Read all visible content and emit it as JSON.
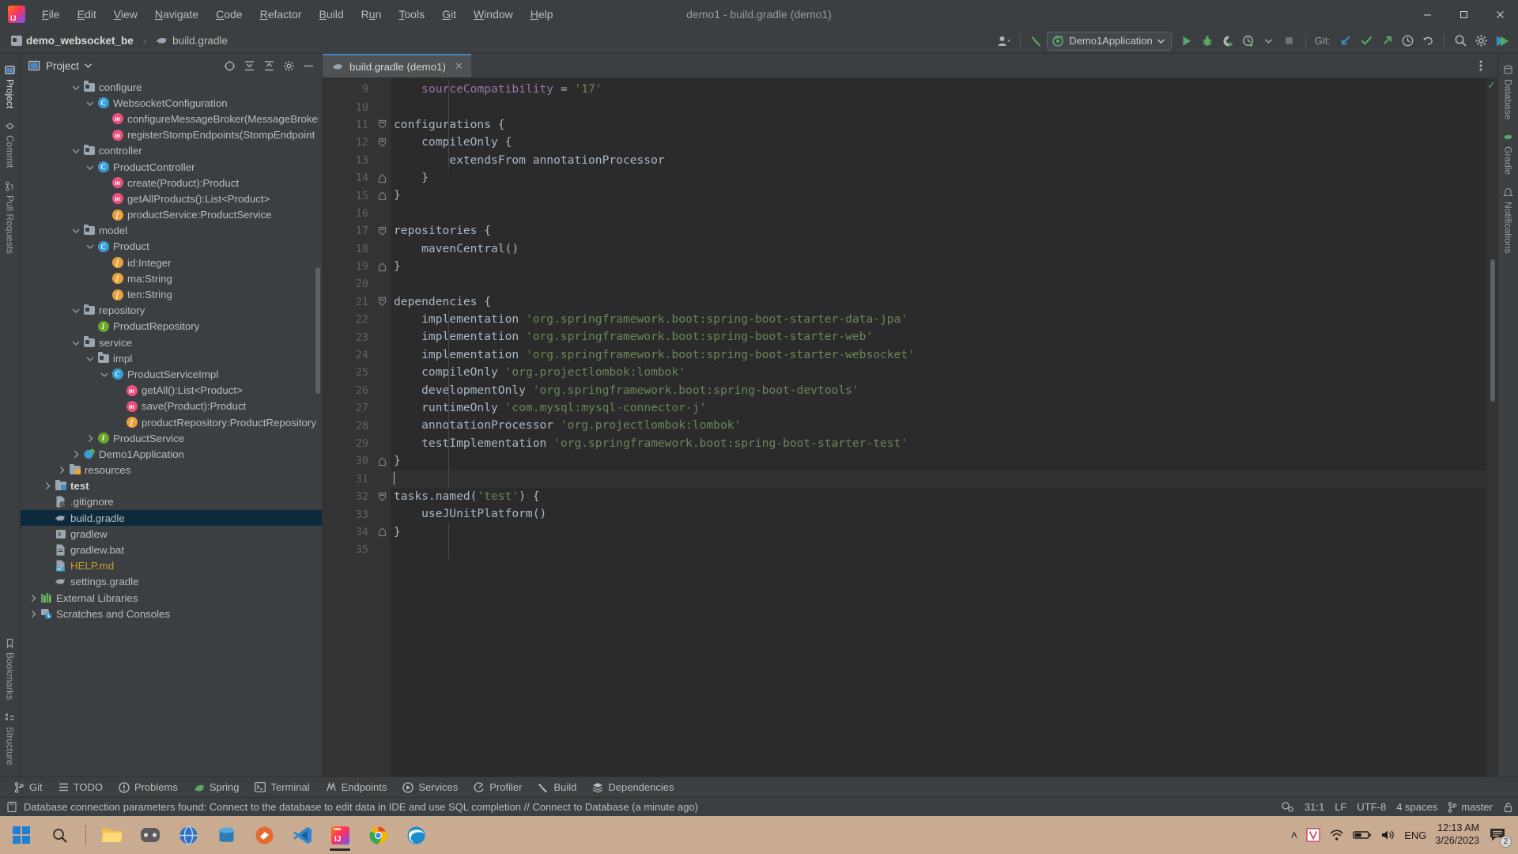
{
  "window": {
    "title": "demo1 - build.gradle (demo1)",
    "minimize_label": "─",
    "maximize_label": "❐",
    "close_label": "✕"
  },
  "menu": {
    "items": [
      {
        "label": "File",
        "mnemonic": "F"
      },
      {
        "label": "Edit",
        "mnemonic": "E"
      },
      {
        "label": "View",
        "mnemonic": "V"
      },
      {
        "label": "Navigate",
        "mnemonic": "N"
      },
      {
        "label": "Code",
        "mnemonic": "C"
      },
      {
        "label": "Refactor",
        "mnemonic": "R"
      },
      {
        "label": "Build",
        "mnemonic": "B"
      },
      {
        "label": "Run",
        "mnemonic": "u"
      },
      {
        "label": "Tools",
        "mnemonic": "T"
      },
      {
        "label": "Git",
        "mnemonic": "G"
      },
      {
        "label": "Window",
        "mnemonic": "W"
      },
      {
        "label": "Help",
        "mnemonic": "H"
      }
    ]
  },
  "navbar": {
    "breadcrumb": [
      "demo_websocket_be",
      "build.gradle"
    ],
    "separator": "›",
    "run_config": "Demo1Application",
    "git_label": "Git:",
    "buttons": [
      {
        "name": "account-icon",
        "title": "Account"
      },
      {
        "name": "build-hammer-icon",
        "title": "Build"
      },
      {
        "name": "run-icon",
        "title": "Run"
      },
      {
        "name": "debug-icon",
        "title": "Debug"
      },
      {
        "name": "run-with-coverage-icon",
        "title": "Run with Coverage"
      },
      {
        "name": "profiler-icon",
        "title": "Profiler"
      },
      {
        "name": "stop-icon",
        "title": "Stop"
      },
      {
        "name": "git-update-icon",
        "title": "Update Project"
      },
      {
        "name": "git-commit-icon",
        "title": "Commit"
      },
      {
        "name": "git-push-icon",
        "title": "Push"
      },
      {
        "name": "git-history-icon",
        "title": "History"
      },
      {
        "name": "git-rollback-icon",
        "title": "Rollback"
      },
      {
        "name": "search-everywhere-icon",
        "title": "Search Everywhere"
      },
      {
        "name": "settings-gear-icon",
        "title": "Settings"
      },
      {
        "name": "updates-icon",
        "title": "IDE and Plugin Updates"
      }
    ]
  },
  "left_strip": {
    "tabs": [
      {
        "label": "Project",
        "icon": "project-icon",
        "selected": true
      },
      {
        "label": "Commit",
        "icon": "commit-icon",
        "selected": false
      },
      {
        "label": "Pull Requests",
        "icon": "pull-request-icon",
        "selected": false
      }
    ],
    "bottom_tabs": [
      {
        "label": "Bookmarks",
        "icon": "bookmark-icon"
      },
      {
        "label": "Structure",
        "icon": "structure-icon"
      }
    ]
  },
  "right_strip": {
    "tabs": [
      {
        "label": "Database",
        "icon": "database-icon"
      },
      {
        "label": "Gradle",
        "icon": "gradle-icon"
      },
      {
        "label": "Notifications",
        "icon": "notifications-icon"
      }
    ]
  },
  "project_panel": {
    "title": "Project",
    "header_icons": [
      {
        "name": "scroll-from-source-icon"
      },
      {
        "name": "expand-all-icon"
      },
      {
        "name": "collapse-all-icon"
      },
      {
        "name": "panel-settings-gear-icon"
      },
      {
        "name": "hide-panel-icon"
      }
    ],
    "tree": [
      {
        "label": "configure",
        "indent": 4,
        "chev": "down",
        "icon": "folder-src",
        "kind": "folder"
      },
      {
        "label": "WebsocketConfiguration",
        "indent": 5,
        "chev": "down",
        "icon": "badge-c",
        "kind": "class"
      },
      {
        "label": "configureMessageBroker(MessageBroker",
        "indent": 6,
        "chev": "none",
        "icon": "badge-m",
        "kind": "method"
      },
      {
        "label": "registerStompEndpoints(StompEndpoint",
        "indent": 6,
        "chev": "none",
        "icon": "badge-m",
        "kind": "method"
      },
      {
        "label": "controller",
        "indent": 4,
        "chev": "down",
        "icon": "folder-src",
        "kind": "folder"
      },
      {
        "label": "ProductController",
        "indent": 5,
        "chev": "down",
        "icon": "badge-c",
        "kind": "class"
      },
      {
        "label": "create(Product):Product",
        "indent": 6,
        "chev": "none",
        "icon": "badge-m",
        "kind": "method"
      },
      {
        "label": "getAllProducts():List<Product>",
        "indent": 6,
        "chev": "none",
        "icon": "badge-m",
        "kind": "method"
      },
      {
        "label": "productService:ProductService",
        "indent": 6,
        "chev": "none",
        "icon": "badge-f",
        "kind": "field"
      },
      {
        "label": "model",
        "indent": 4,
        "chev": "down",
        "icon": "folder-src",
        "kind": "folder"
      },
      {
        "label": "Product",
        "indent": 5,
        "chev": "down",
        "icon": "badge-c",
        "kind": "class"
      },
      {
        "label": "id:Integer",
        "indent": 6,
        "chev": "none",
        "icon": "badge-f",
        "kind": "field"
      },
      {
        "label": "ma:String",
        "indent": 6,
        "chev": "none",
        "icon": "badge-f",
        "kind": "field"
      },
      {
        "label": "ten:String",
        "indent": 6,
        "chev": "none",
        "icon": "badge-f",
        "kind": "field"
      },
      {
        "label": "repository",
        "indent": 4,
        "chev": "down",
        "icon": "folder-src",
        "kind": "folder"
      },
      {
        "label": "ProductRepository",
        "indent": 5,
        "chev": "none",
        "icon": "badge-i",
        "kind": "interface"
      },
      {
        "label": "service",
        "indent": 4,
        "chev": "down",
        "icon": "folder-src",
        "kind": "folder"
      },
      {
        "label": "impl",
        "indent": 5,
        "chev": "down",
        "icon": "folder-src",
        "kind": "folder"
      },
      {
        "label": "ProductServiceImpl",
        "indent": 6,
        "chev": "down",
        "icon": "badge-c",
        "kind": "class"
      },
      {
        "label": "getAll():List<Product>",
        "indent": 7,
        "chev": "none",
        "icon": "badge-m",
        "kind": "method"
      },
      {
        "label": "save(Product):Product",
        "indent": 7,
        "chev": "none",
        "icon": "badge-m",
        "kind": "method"
      },
      {
        "label": "productRepository:ProductRepository",
        "indent": 7,
        "chev": "none",
        "icon": "badge-f",
        "kind": "field"
      },
      {
        "label": "ProductService",
        "indent": 5,
        "chev": "right",
        "icon": "badge-i",
        "kind": "interface"
      },
      {
        "label": "Demo1Application",
        "indent": 4,
        "chev": "right",
        "icon": "spring-class",
        "kind": "class"
      },
      {
        "label": "resources",
        "indent": 3,
        "chev": "right",
        "icon": "folder-res",
        "kind": "folder"
      },
      {
        "label": "test",
        "indent": 2,
        "chev": "right",
        "icon": "folder-test",
        "kind": "folder",
        "bold": true
      },
      {
        "label": ".gitignore",
        "indent": 2,
        "chev": "none",
        "icon": "file-gitignore",
        "kind": "file"
      },
      {
        "label": "build.gradle",
        "indent": 2,
        "chev": "none",
        "icon": "file-gradle",
        "kind": "file",
        "selected": true
      },
      {
        "label": "gradlew",
        "indent": 2,
        "chev": "none",
        "icon": "file-script",
        "kind": "file"
      },
      {
        "label": "gradlew.bat",
        "indent": 2,
        "chev": "none",
        "icon": "file-text",
        "kind": "file"
      },
      {
        "label": "HELP.md",
        "indent": 2,
        "chev": "none",
        "icon": "file-md",
        "kind": "file",
        "color": "help"
      },
      {
        "label": "settings.gradle",
        "indent": 2,
        "chev": "none",
        "icon": "file-gradle",
        "kind": "file"
      },
      {
        "label": "External Libraries",
        "indent": 1,
        "chev": "right",
        "icon": "libraries",
        "kind": "node"
      },
      {
        "label": "Scratches and Consoles",
        "indent": 1,
        "chev": "right",
        "icon": "scratches",
        "kind": "node"
      }
    ]
  },
  "editor": {
    "tab": {
      "label": "build.gradle (demo1)",
      "close": "✕",
      "icon": "gradle-file-icon"
    },
    "options_icon": "editor-options-icon",
    "inspection_status": "✓",
    "first_line_number": 9,
    "lines": [
      {
        "n": 9,
        "fold": "none",
        "tokens": [
          {
            "t": "    ",
            "c": "pl"
          },
          {
            "t": "sourceCompatibility",
            "c": "prop"
          },
          {
            "t": " = ",
            "c": "pl"
          },
          {
            "t": "'17'",
            "c": "str"
          }
        ]
      },
      {
        "n": 10,
        "fold": "none",
        "tokens": []
      },
      {
        "n": 11,
        "fold": "start",
        "tokens": [
          {
            "t": "configurations {",
            "c": "pl"
          }
        ]
      },
      {
        "n": 12,
        "fold": "start",
        "tokens": [
          {
            "t": "    compileOnly {",
            "c": "pl"
          }
        ]
      },
      {
        "n": 13,
        "fold": "none",
        "tokens": [
          {
            "t": "        extendsFrom annotationProcessor",
            "c": "pl"
          }
        ]
      },
      {
        "n": 14,
        "fold": "end",
        "tokens": [
          {
            "t": "    }",
            "c": "pl"
          }
        ]
      },
      {
        "n": 15,
        "fold": "end",
        "tokens": [
          {
            "t": "}",
            "c": "pl"
          }
        ]
      },
      {
        "n": 16,
        "fold": "none",
        "tokens": []
      },
      {
        "n": 17,
        "fold": "start",
        "tokens": [
          {
            "t": "repositories {",
            "c": "pl"
          }
        ]
      },
      {
        "n": 18,
        "fold": "none",
        "tokens": [
          {
            "t": "    mavenCentral()",
            "c": "pl"
          }
        ]
      },
      {
        "n": 19,
        "fold": "end",
        "tokens": [
          {
            "t": "}",
            "c": "pl"
          }
        ]
      },
      {
        "n": 20,
        "fold": "none",
        "tokens": []
      },
      {
        "n": 21,
        "fold": "start",
        "run": true,
        "tokens": [
          {
            "t": "dependencies {",
            "c": "pl"
          }
        ]
      },
      {
        "n": 22,
        "fold": "none",
        "tokens": [
          {
            "t": "    implementation ",
            "c": "pl"
          },
          {
            "t": "'org.springframework.boot:spring-boot-starter-data-jpa'",
            "c": "str"
          }
        ]
      },
      {
        "n": 23,
        "fold": "none",
        "tokens": [
          {
            "t": "    implementation ",
            "c": "pl"
          },
          {
            "t": "'org.springframework.boot:spring-boot-starter-web'",
            "c": "str"
          }
        ]
      },
      {
        "n": 24,
        "fold": "none",
        "tokens": [
          {
            "t": "    implementation ",
            "c": "pl"
          },
          {
            "t": "'org.springframework.boot:spring-boot-starter-websocket'",
            "c": "str"
          }
        ]
      },
      {
        "n": 25,
        "fold": "none",
        "tokens": [
          {
            "t": "    compileOnly ",
            "c": "pl"
          },
          {
            "t": "'org.projectlombok:lombok'",
            "c": "str"
          }
        ]
      },
      {
        "n": 26,
        "fold": "none",
        "tokens": [
          {
            "t": "    developmentOnly ",
            "c": "pl"
          },
          {
            "t": "'org.springframework.boot:spring-boot-devtools'",
            "c": "str"
          }
        ]
      },
      {
        "n": 27,
        "fold": "none",
        "tokens": [
          {
            "t": "    runtimeOnly ",
            "c": "pl"
          },
          {
            "t": "'com.mysql:mysql-connector-j'",
            "c": "str"
          }
        ]
      },
      {
        "n": 28,
        "fold": "none",
        "tokens": [
          {
            "t": "    annotationProcessor ",
            "c": "pl"
          },
          {
            "t": "'org.projectlombok:lombok'",
            "c": "str"
          }
        ]
      },
      {
        "n": 29,
        "fold": "none",
        "tokens": [
          {
            "t": "    testImplementation ",
            "c": "pl"
          },
          {
            "t": "'org.springframework.boot:spring-boot-starter-test'",
            "c": "str"
          }
        ]
      },
      {
        "n": 30,
        "fold": "end",
        "tokens": [
          {
            "t": "}",
            "c": "pl"
          }
        ]
      },
      {
        "n": 31,
        "fold": "none",
        "current": true,
        "caret": true,
        "tokens": []
      },
      {
        "n": 32,
        "fold": "start",
        "tokens": [
          {
            "t": "tasks.named(",
            "c": "pl"
          },
          {
            "t": "'test'",
            "c": "str"
          },
          {
            "t": ") {",
            "c": "pl"
          }
        ]
      },
      {
        "n": 33,
        "fold": "none",
        "tokens": [
          {
            "t": "    useJUnitPlatform()",
            "c": "pl"
          }
        ]
      },
      {
        "n": 34,
        "fold": "end",
        "tokens": [
          {
            "t": "}",
            "c": "pl"
          }
        ]
      },
      {
        "n": 35,
        "fold": "none",
        "tokens": []
      }
    ]
  },
  "tool_windows": [
    {
      "label": "Git",
      "icon": "git-branch-icon"
    },
    {
      "label": "TODO",
      "icon": "todo-icon"
    },
    {
      "label": "Problems",
      "icon": "problems-icon"
    },
    {
      "label": "Spring",
      "icon": "spring-leaf-icon"
    },
    {
      "label": "Terminal",
      "icon": "terminal-icon"
    },
    {
      "label": "Endpoints",
      "icon": "endpoints-icon"
    },
    {
      "label": "Services",
      "icon": "services-icon"
    },
    {
      "label": "Profiler",
      "icon": "profiler-icon"
    },
    {
      "label": "Build",
      "icon": "build-hammer-icon"
    },
    {
      "label": "Dependencies",
      "icon": "dependencies-icon"
    }
  ],
  "status_bar": {
    "message": "Database connection parameters found: Connect to the database to edit data in IDE and use SQL completion // Connect to Database (a minute ago)",
    "message_icon": "database-notification-icon",
    "caret_position": "31:1",
    "line_separator": "LF",
    "encoding": "UTF-8",
    "indent": "4 spaces",
    "branch": "master",
    "branch_icon": "git-branch-icon",
    "lock_icon": "read-only-lock-icon",
    "inspections_icon": "inspections-gear-icon"
  },
  "taskbar": {
    "start_icon": "windows-start-icon",
    "search_icon": "search-icon",
    "apps": [
      {
        "name": "file-explorer-icon",
        "active": false
      },
      {
        "name": "xbox-icon",
        "active": false
      },
      {
        "name": "browser-blue-icon",
        "active": false
      },
      {
        "name": "database-app-icon",
        "active": false
      },
      {
        "name": "postman-icon",
        "active": false
      },
      {
        "name": "vscode-icon",
        "active": false
      },
      {
        "name": "intellij-idea-icon",
        "active": true
      },
      {
        "name": "chrome-icon",
        "active": false
      },
      {
        "name": "edge-icon",
        "active": false
      }
    ],
    "tray": {
      "chevron": "˄",
      "items": [
        "show-hidden-icons",
        "v-app-icon",
        "wifi-icon",
        "battery-icon",
        "volume-icon"
      ],
      "language": "ENG",
      "time": "12:13 AM",
      "date": "3/26/2023",
      "notification_count": "2"
    }
  }
}
